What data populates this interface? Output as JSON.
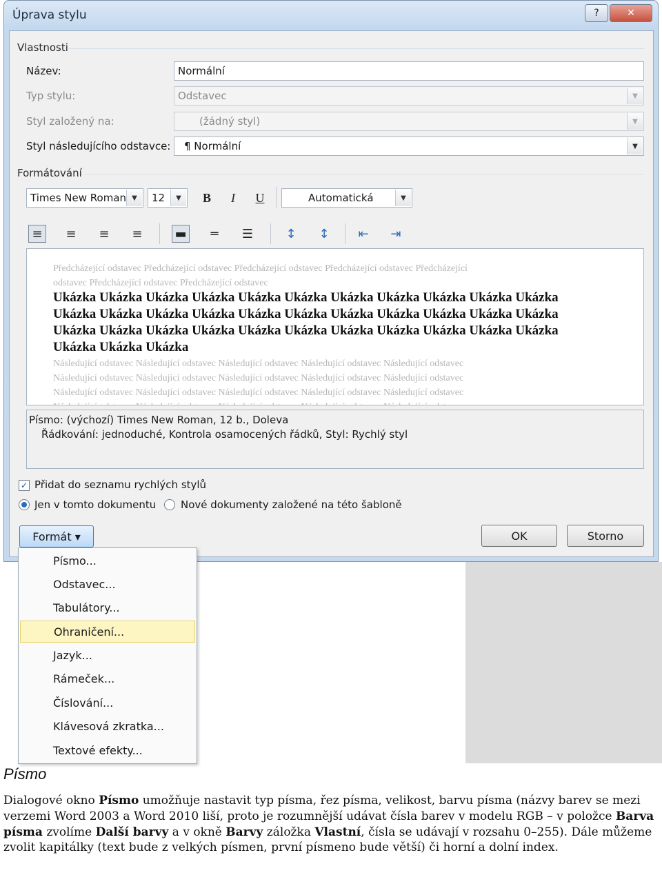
{
  "dialog": {
    "title": "Úprava stylu",
    "help_glyph": "?",
    "close_glyph": "✕",
    "group_properties": "Vlastnosti",
    "name_label": "Název:",
    "name_value": "Normální",
    "type_label": "Typ stylu:",
    "type_value": "Odstavec",
    "based_label": "Styl založený na:",
    "based_value": "(žádný styl)",
    "next_label": "Styl následujícího odstavce:",
    "next_value": "¶ Normální",
    "group_formatting": "Formátování",
    "font_value": "Times New Roman",
    "size_value": "12",
    "bold_glyph": "B",
    "italic_glyph": "I",
    "underline_glyph": "U",
    "color_value": "Automatická",
    "align_left_glyph": "≡",
    "align_center_glyph": "≡",
    "align_right_glyph": "≡",
    "align_justify_glyph": "≡",
    "spacing_single_glyph": "▬",
    "spacing_onehalf_glyph": "═",
    "spacing_double_glyph": "☰",
    "space_before_glyph": "↕",
    "space_after_glyph": "↕",
    "indent_decrease_glyph": "⇤",
    "indent_increase_glyph": "⇥",
    "preview": {
      "prev_1": "Předcházející odstavec Předcházející odstavec Předcházející odstavec Předcházející odstavec Předcházející",
      "prev_2": "odstavec Předcházející odstavec Předcházející odstavec",
      "sample_1": "Ukázka Ukázka Ukázka Ukázka Ukázka Ukázka Ukázka Ukázka Ukázka Ukázka Ukázka",
      "sample_2": "Ukázka Ukázka Ukázka Ukázka Ukázka Ukázka Ukázka Ukázka Ukázka Ukázka Ukázka",
      "sample_3": "Ukázka Ukázka Ukázka Ukázka Ukázka Ukázka Ukázka Ukázka Ukázka Ukázka Ukázka",
      "sample_4": "Ukázka Ukázka Ukázka",
      "next_1": "Následující odstavec Následující odstavec Následující odstavec Následující odstavec Následující odstavec",
      "next_2": "Následující odstavec Následující odstavec Následující odstavec Následující odstavec Následující odstavec",
      "next_3": "Následující odstavec Následující odstavec Následující odstavec Následující odstavec Následující odstavec",
      "next_4": "Následující odstavec Následující odstavec Následující odstavec Následující odstavec Následující odstavec"
    },
    "desc_line1": "Písmo: (výchozí) Times New Roman, 12 b., Doleva",
    "desc_line2": "Řádkování:  jednoduché, Kontrola osamocených řádků, Styl: Rychlý styl",
    "check_glyph": "✓",
    "add_quick_label": "Přidat do seznamu rychlých stylů",
    "only_doc_label": "Jen v tomto dokumentu",
    "new_docs_label": "Nové dokumenty založené na této šabloně",
    "format_button": "Formát ▾",
    "ok_button": "OK",
    "cancel_button": "Storno",
    "menu": [
      "Písmo...",
      "Odstavec...",
      "Tabulátory...",
      "Ohraničení...",
      "Jazyk...",
      "Rámeček...",
      "Číslování...",
      "Klávesová zkratka...",
      "Textové efekty..."
    ]
  },
  "article": {
    "heading": "Písmo",
    "p1_a": "Dialogové okno ",
    "p1_b": "Písmo",
    "p1_c": " umožňuje nastavit typ písma, řez písma, velikost, barvu písma (názvy barev se mezi verzemi Word 2003 a Word 2010 liší, proto je rozumnější udávat čísla barev v modelu RGB – v položce ",
    "p1_d": "Barva písma",
    "p1_e": " zvolíme ",
    "p1_f": "Další barvy",
    "p1_g": " a v okně ",
    "p1_h": "Barvy",
    "p1_i": " záložka ",
    "p1_j": "Vlastní",
    "p1_k": ", čísla se udávají v rozsahu 0–255). Dále můžeme zvolit kapitálky (text bude z velkých písmen, první písmeno bude větší) či horní a dolní index."
  }
}
